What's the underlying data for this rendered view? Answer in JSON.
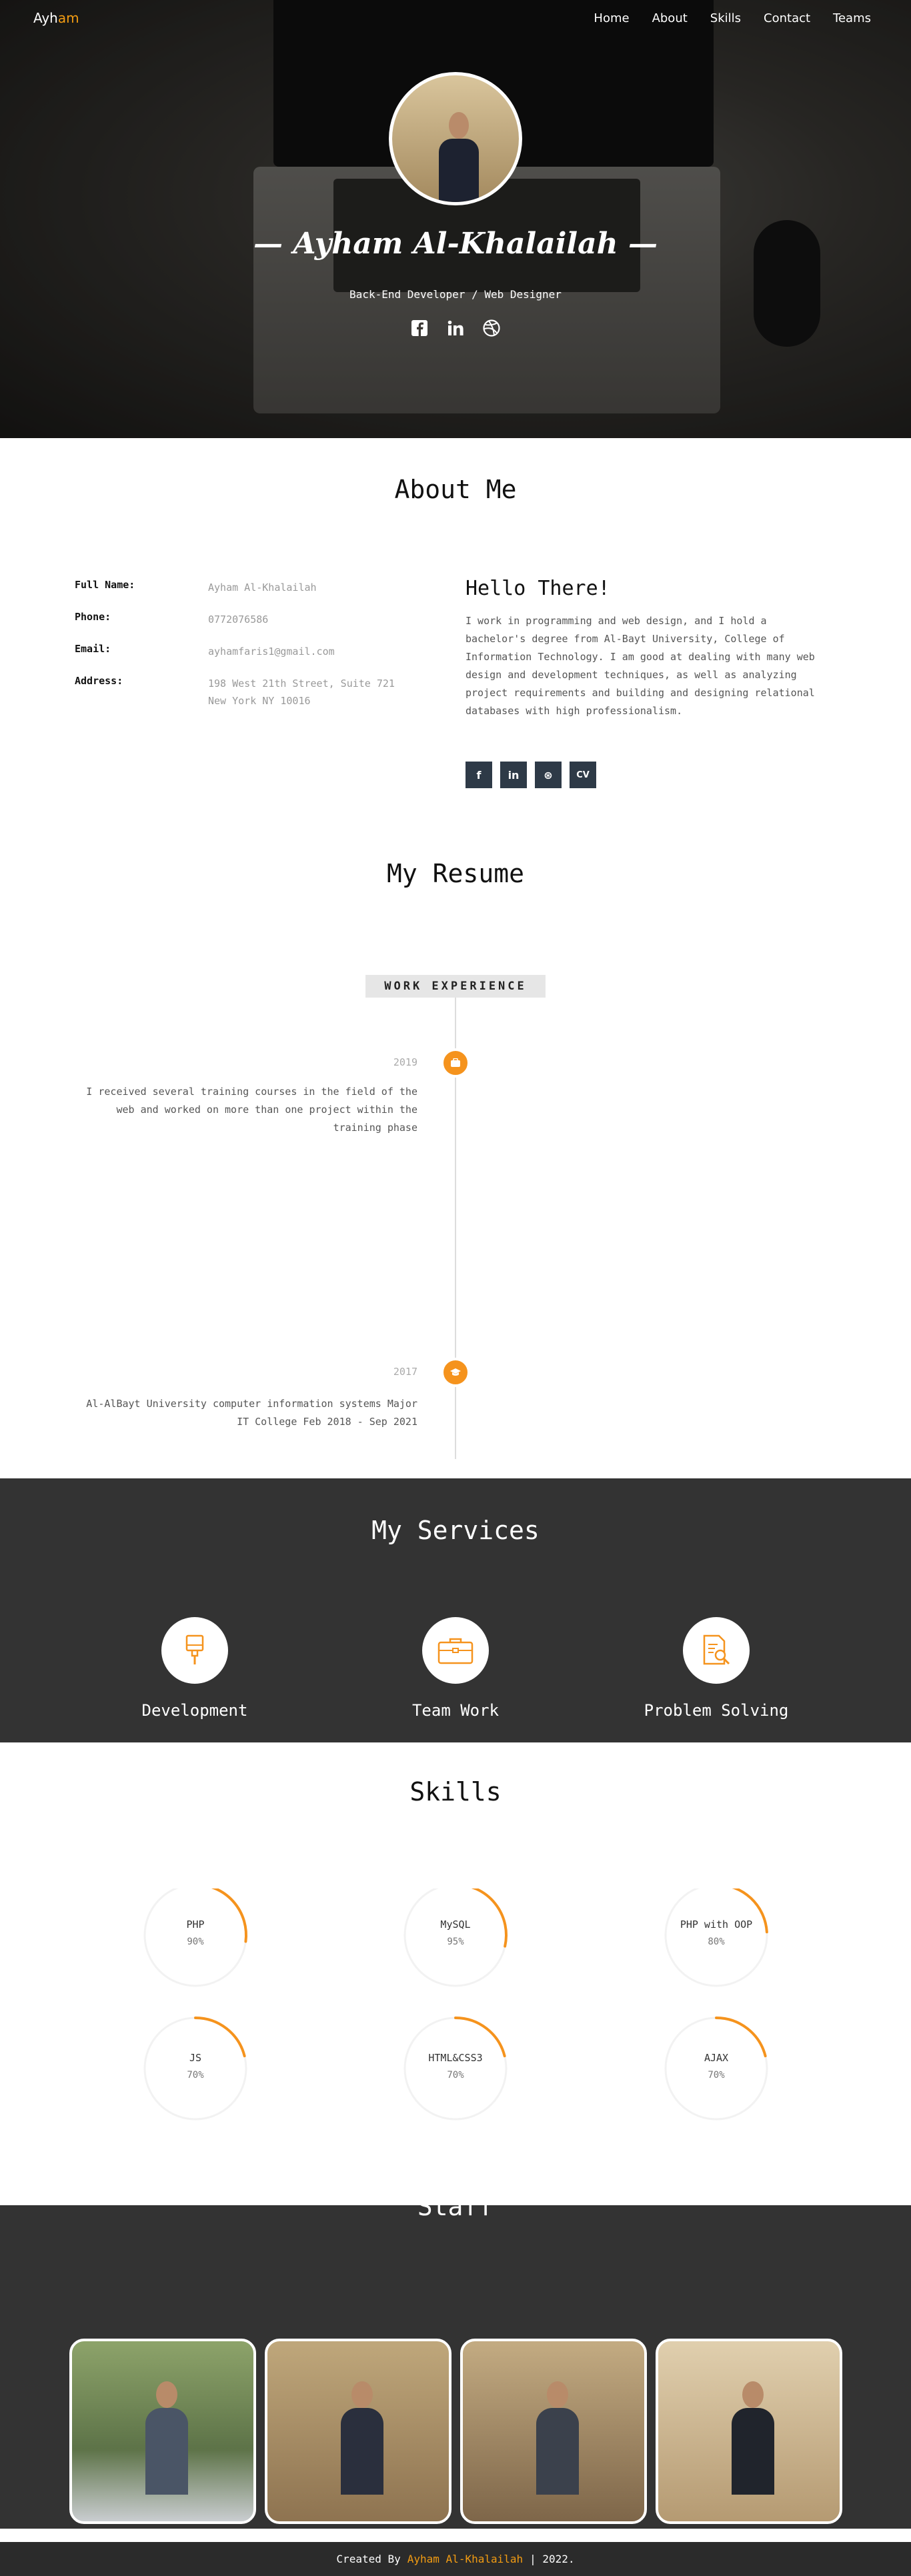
{
  "nav": {
    "logo_main": "Ayh",
    "logo_accent": "am",
    "links": [
      "Home",
      "About",
      "Skills",
      "Contact",
      "Teams"
    ]
  },
  "hero": {
    "name": "— Ayham Al-Khalailah —",
    "role": "Back-End Developer / Web Designer",
    "social": [
      "facebook-icon",
      "linkedin-icon",
      "dribbble-icon"
    ]
  },
  "about": {
    "title": "About Me",
    "info": [
      {
        "label": "Full Name:",
        "value": "Ayham Al-Khalailah"
      },
      {
        "label": "Phone:",
        "value": "0772076586"
      },
      {
        "label": "Email:",
        "value": "ayhamfaris1@gmail.com"
      },
      {
        "label": "Address:",
        "value": "198 West 21th Street, Suite 721 New York NY 10016"
      }
    ],
    "hello": "Hello There!",
    "text": "I work in programming and web design, and I hold a bachelor's degree from Al-Bayt University, College of Information Technology. I am good at dealing with many web design and development techniques, as well as analyzing project requirements and building and designing relational databases with high professionalism.",
    "social_labels": [
      "f",
      "in",
      "⊛",
      "CV"
    ]
  },
  "resume": {
    "title": "My Resume",
    "badge": "WORK EXPERIENCE",
    "items": [
      {
        "year": "2019",
        "text": "I received several training courses in the field of the web and worked on more than one project within the training phase"
      },
      {
        "year": "2017",
        "text": "Al-AlBayt University computer information systems Major IT College Feb 2018 - Sep 2021"
      }
    ]
  },
  "services": {
    "title": "My Services",
    "items": [
      {
        "label": "Development",
        "icon": "brush-icon"
      },
      {
        "label": "Team Work",
        "icon": "briefcase-icon"
      },
      {
        "label": "Problem Solving",
        "icon": "document-search-icon"
      }
    ]
  },
  "skills": {
    "title": "Skills",
    "items": [
      {
        "name": "PHP",
        "percent": "90%",
        "value": 90
      },
      {
        "name": "MySQL",
        "percent": "95%",
        "value": 95
      },
      {
        "name": "PHP with OOP",
        "percent": "80%",
        "value": 80
      },
      {
        "name": "JS",
        "percent": "70%",
        "value": 70
      },
      {
        "name": "HTML&CSS3",
        "percent": "70%",
        "value": 70
      },
      {
        "name": "AJAX",
        "percent": "70%",
        "value": 70
      }
    ],
    "accent_color": "#f5931d"
  },
  "staff": {
    "title": "Staff"
  },
  "footer": {
    "prefix": "Created By",
    "author": "Ayham Al-Khalailah",
    "suffix": "| 2022."
  }
}
